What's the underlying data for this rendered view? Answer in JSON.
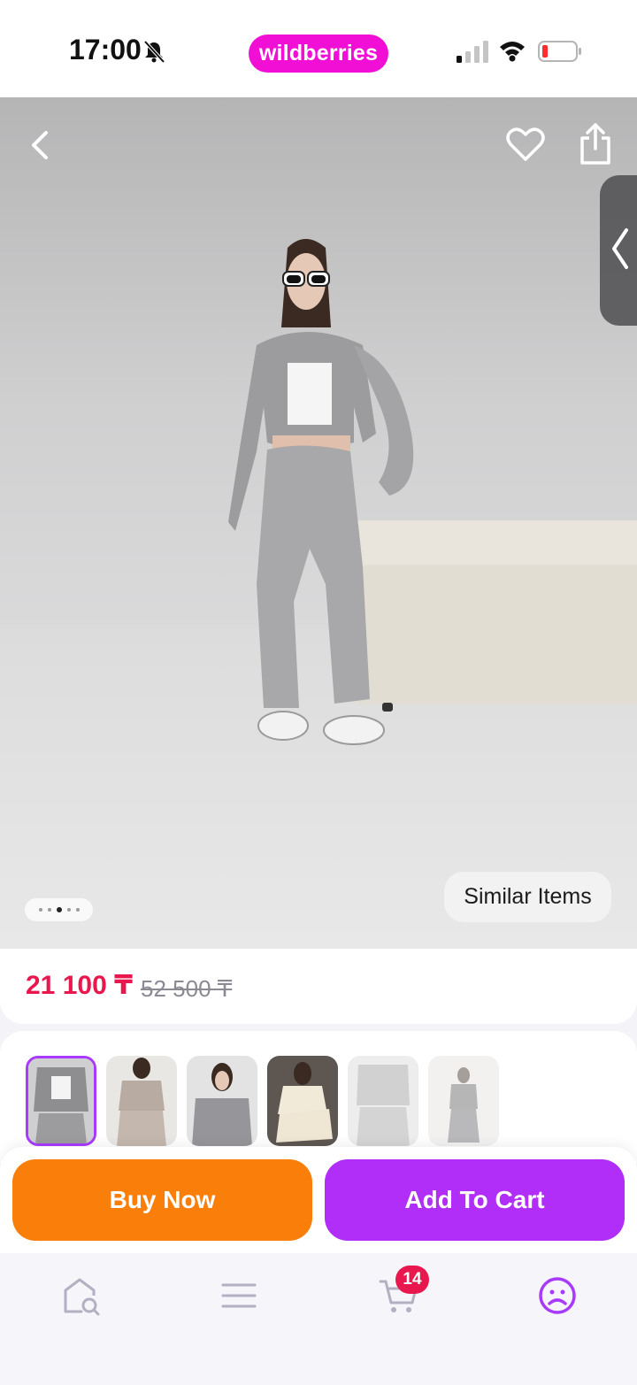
{
  "status_bar": {
    "time": "17:00",
    "brand": "wildberries"
  },
  "product": {
    "price_current": "21 100 ₸",
    "price_old": "52 500 ₸",
    "similar_label": "Similar Items",
    "gallery_index": 3,
    "gallery_count": 5
  },
  "actions": {
    "buy_label": "Buy Now",
    "cart_label": "Add To Cart"
  },
  "tab_bar": {
    "cart_count": "14"
  },
  "colors": {
    "brand": "#f10fd6",
    "price": "#e8174d",
    "buy": "#fa7e0a",
    "cart": "#b02ef7"
  },
  "icons": [
    "back-icon",
    "heart-icon",
    "share-icon",
    "chevron-left-icon",
    "home-search-icon",
    "menu-icon",
    "cart-icon",
    "profile-icon"
  ]
}
